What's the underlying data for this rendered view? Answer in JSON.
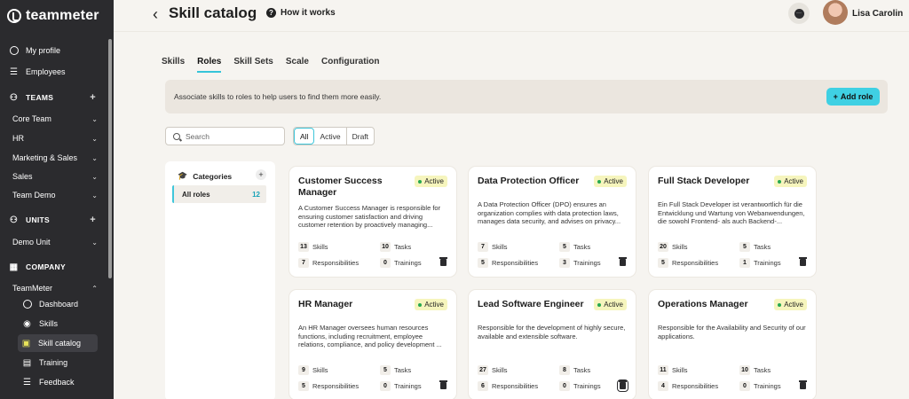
{
  "brand": {
    "name": "teammeter"
  },
  "sidebar": {
    "items": [
      {
        "label": "My profile",
        "icon": "user-circle-icon"
      },
      {
        "label": "Employees",
        "icon": "people-list-icon"
      }
    ],
    "teams": {
      "label": "TEAMS",
      "items": [
        "Core Team",
        "HR",
        "Marketing & Sales",
        "Sales",
        "Team Demo"
      ]
    },
    "units": {
      "label": "UNITS",
      "items": [
        "Demo Unit"
      ]
    },
    "company": {
      "label": "COMPANY",
      "group": "TeamMeter",
      "items": [
        "Dashboard",
        "Skills",
        "Skill catalog",
        "Training",
        "Feedback"
      ]
    }
  },
  "header": {
    "title": "Skill catalog",
    "how_it_works": "How it works",
    "user_name": "Lisa Carolin"
  },
  "tabs": [
    "Skills",
    "Roles",
    "Skill Sets",
    "Scale",
    "Configuration"
  ],
  "active_tab": "Roles",
  "info": {
    "text": "Associate skills to roles to help users to find them more easily.",
    "add_role": "Add role"
  },
  "filters": {
    "search_placeholder": "Search",
    "status_options": [
      "All",
      "Active",
      "Draft"
    ],
    "selected": "All"
  },
  "categories": {
    "title": "Categories",
    "items": [
      {
        "label": "All roles",
        "count": "12"
      }
    ]
  },
  "labels": {
    "skills": "Skills",
    "tasks": "Tasks",
    "responsibilities": "Responsibilities",
    "trainings": "Trainings",
    "active": "Active"
  },
  "roles": [
    {
      "title": "Customer Success Manager",
      "status": "Active",
      "description": "A Customer Success Manager is responsible for ensuring customer satisfaction and driving customer retention by proactively managing...",
      "skills": "13",
      "tasks": "10",
      "responsibilities": "7",
      "trainings": "0"
    },
    {
      "title": "Data Protection Officer",
      "status": "Active",
      "description": "A Data Protection Officer (DPO) ensures an organization complies with data protection laws, manages data security, and advises on privacy...",
      "skills": "7",
      "tasks": "5",
      "responsibilities": "5",
      "trainings": "3"
    },
    {
      "title": "Full Stack Developer",
      "status": "Active",
      "description": "Ein Full Stack Developer ist verantwortlich für die Entwicklung und Wartung von Webanwendungen, die sowohl Frontend- als auch Backend-...",
      "skills": "20",
      "tasks": "5",
      "responsibilities": "5",
      "trainings": "1"
    },
    {
      "title": "HR Manager",
      "status": "Active",
      "description": "An HR Manager oversees human resources functions, including recruitment, employee relations, compliance, and policy development ...",
      "skills": "9",
      "tasks": "5",
      "responsibilities": "5",
      "trainings": "0"
    },
    {
      "title": "Lead Software Engineer",
      "status": "Active",
      "description": "Responsible for the development of highly secure, available and extensible software.",
      "skills": "27",
      "tasks": "8",
      "responsibilities": "6",
      "trainings": "0"
    },
    {
      "title": "Operations Manager",
      "status": "Active",
      "description": "Responsible for the Availability and Security of our applications.",
      "skills": "11",
      "tasks": "10",
      "responsibilities": "4",
      "trainings": "0"
    }
  ]
}
